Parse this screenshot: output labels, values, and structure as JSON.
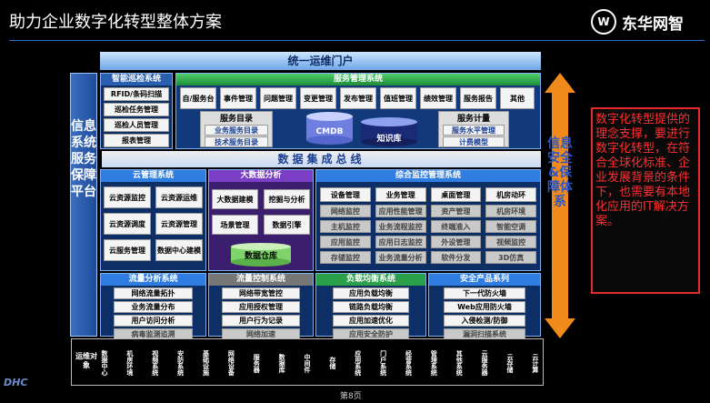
{
  "page": {
    "title": "助力企业数字化转型整体方案",
    "page_number": "第8页"
  },
  "logo": {
    "text": "东华网智"
  },
  "corner_logo": "DHC",
  "portal": "统一运维门户",
  "left_panel": "信息系统服务保障平台",
  "right_panel": "信息安全&保障体系",
  "bus": "数据集成总线",
  "red_note": "数字化转型提供的理念支撑，要进行数字化转型，在符合全球化标准、企业发展背景的条件下，也需要有本地化应用的IT解决方案。",
  "patrol": {
    "title": "智能巡检系统",
    "items": [
      "RFID/条码扫描",
      "巡检任务管理",
      "巡检人员管理",
      "报表管理"
    ]
  },
  "service_mgmt": {
    "title": "服务管理系统",
    "items": [
      "自/服务台",
      "事件管理",
      "问题管理",
      "变更管理",
      "发布管理",
      "值班管理",
      "绩效管理",
      "服务报告",
      "其他"
    ],
    "catalog_title": "服务目录",
    "catalog_items": [
      "业务服务目录",
      "技术服务目录"
    ],
    "cmdb": "CMDB",
    "kb": "知识库",
    "sla_title": "服务计量",
    "sla_items": [
      "服务水平管理",
      "计费模型"
    ]
  },
  "cloud": {
    "title": "云管理系统",
    "items": [
      "云资源监控",
      "云资源运维",
      "云资源调度",
      "云资源管理",
      "云服务管理",
      "数据中心建模"
    ]
  },
  "bigdata": {
    "title": "大数据分析",
    "items": [
      "大数据建模",
      "挖掘与分析",
      "场景管理",
      "数据引擎"
    ],
    "warehouse": "数据仓库"
  },
  "monitor": {
    "title": "综合监控管理系统",
    "row1": [
      "设备管理",
      "业务管理",
      "桌面管理",
      "机房动环"
    ],
    "row2": [
      "网络监控",
      "应用性能管理",
      "资产管理",
      "机房环境"
    ],
    "row3": [
      "主机监控",
      "业务流程监控",
      "终端准入",
      "智能空调"
    ],
    "row4": [
      "应用监控",
      "应用日志监控",
      "外设管理",
      "视频监控"
    ],
    "row5": [
      "存储监控",
      "业务流量分析",
      "软件分发",
      "3D仿真"
    ]
  },
  "flow_analysis": {
    "title": "流量分析系统",
    "items": [
      "网络流量拓扑",
      "业务流量分布",
      "用户访问分析",
      "病毒监测追溯"
    ]
  },
  "flow_control": {
    "title": "流量控制系统",
    "items": [
      "网络带宽管控",
      "应用授权管理",
      "用户行为记录",
      "网络加速"
    ]
  },
  "lb": {
    "title": "负载均衡系统",
    "items": [
      "应用负载均衡",
      "链路负载均衡",
      "应用加速优化",
      "应用安全防护"
    ]
  },
  "security": {
    "title": "安全产品系列",
    "items": [
      "下一代防火墙",
      "Web应用防火墙",
      "入侵检测/防御",
      "漏洞扫描系统"
    ]
  },
  "bottom": {
    "label": "运维对象",
    "cols": [
      "数据中心",
      "机房环境",
      "视频系统",
      "安防系统",
      "基础设施",
      "网络设备",
      "服务器",
      "数据库",
      "中间件",
      "存储",
      "应用系统",
      "门户系统",
      "经营系统",
      "管理系统",
      "其他系统",
      "云服务器",
      "云存储",
      "云计算"
    ]
  }
}
